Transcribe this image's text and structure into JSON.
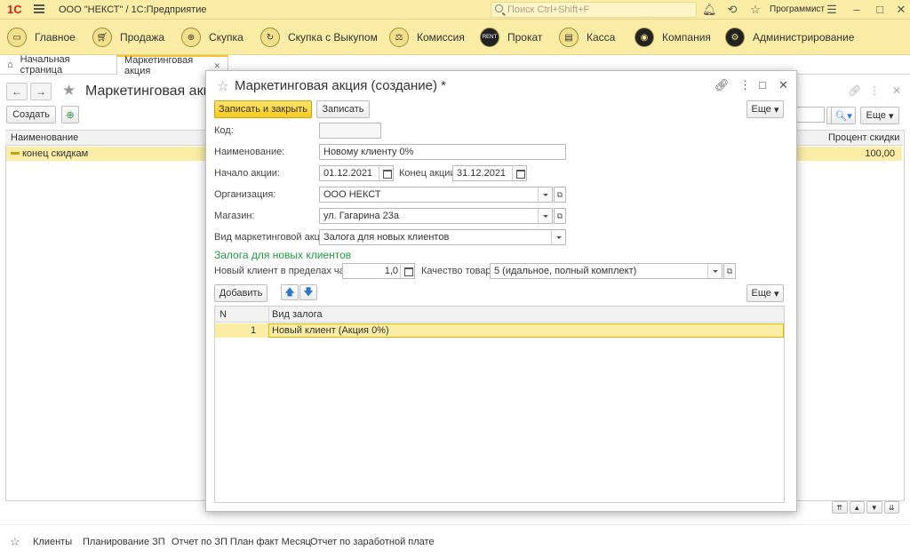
{
  "titlebar": {
    "logo": "1С",
    "title": "ООО \"НЕКСТ\" / 1С:Предприятие",
    "search_placeholder": "Поиск Ctrl+Shift+F",
    "user": "Программист"
  },
  "sections": [
    {
      "label": "Главное",
      "icon": "home-icon"
    },
    {
      "label": "Продажа",
      "icon": "cart-icon"
    },
    {
      "label": "Скупка",
      "icon": "basket-icon"
    },
    {
      "label": "Скупка с Выкупом",
      "icon": "cycle-icon"
    },
    {
      "label": "Комиссия",
      "icon": "scales-icon"
    },
    {
      "label": "Прокат",
      "icon": "rent-icon"
    },
    {
      "label": "Касса",
      "icon": "register-icon"
    },
    {
      "label": "Компания",
      "icon": "company-icon"
    },
    {
      "label": "Администрирование",
      "icon": "gears-icon"
    }
  ],
  "tabs": {
    "home": "Начальная страница",
    "active": "Маркетинговая акция"
  },
  "bglist": {
    "title": "Маркетинговая акци",
    "create": "Создать",
    "more": "Еще",
    "col_name": "Наименование",
    "col_percent": "Процент скидки",
    "row_name": "конец скидкам",
    "row_percent": "100,00"
  },
  "modal": {
    "title": "Маркетинговая акция (создание) *",
    "save_close": "Записать и закрыть",
    "save": "Записать",
    "more": "Еще",
    "code_label": "Код:",
    "code_value": "",
    "name_label": "Наименование:",
    "name_value": "Новому клиенту 0%",
    "start_label": "Начало акции:",
    "start_value": "01.12.2021",
    "end_label": "Конец акции:",
    "end_value": "31.12.2021",
    "org_label": "Организация:",
    "org_value": "ООО НЕКСТ",
    "shop_label": "Магазин:",
    "shop_value": "ул. Гагарина 23а",
    "type_label": "Вид маркетинговой акции:",
    "type_value": "Залога для новых клиентов",
    "group_title": "Залога для новых клиентов",
    "hours_label": "Новый клиент в пределах часов:",
    "hours_value": "1,0",
    "quality_label": "Качество товара:",
    "quality_value": "5 (идальное, полный комплект)",
    "add": "Добавить",
    "grid_more": "Еще",
    "col_n": "N",
    "col_kind": "Вид залога",
    "rows": [
      {
        "n": "1",
        "kind": "Новый клиент (Акция 0%)"
      }
    ]
  },
  "bottom": {
    "links": [
      "Клиенты",
      "Планирование ЗП",
      "Отчет по ЗП План факт Месяц",
      "Отчет по заработной плате"
    ]
  }
}
